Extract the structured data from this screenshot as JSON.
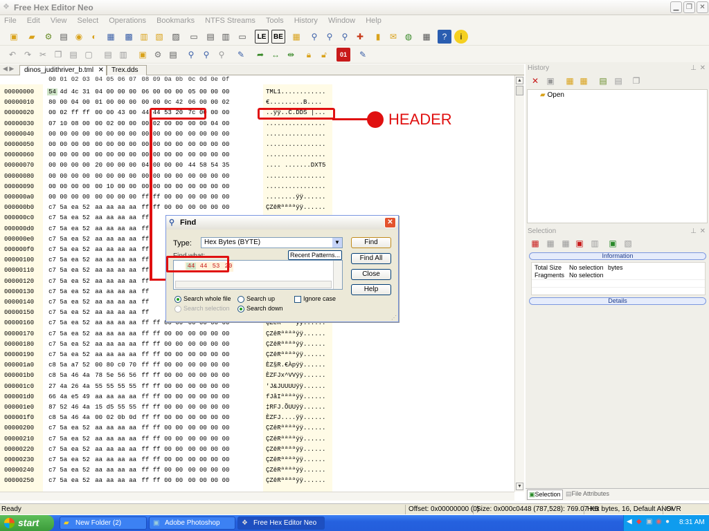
{
  "window": {
    "title": "Free Hex Editor Neo"
  },
  "menu": [
    "File",
    "Edit",
    "View",
    "Select",
    "Operations",
    "Bookmarks",
    "NTFS Streams",
    "Tools",
    "History",
    "Window",
    "Help"
  ],
  "tabs": [
    {
      "label": "dinos_judithriver_b.tml"
    },
    {
      "label": "Trex.dds"
    }
  ],
  "hex": {
    "columns": [
      "00",
      "01",
      "02",
      "03",
      "04",
      "05",
      "06",
      "07",
      "08",
      "09",
      "0a",
      "0b",
      "0c",
      "0d",
      "0e",
      "0f"
    ],
    "rows": [
      {
        "addr": "00000000",
        "bytes": [
          "54",
          "4d",
          "4c",
          "31",
          "04",
          "00",
          "00",
          "00",
          "06",
          "00",
          "00",
          "00",
          "05",
          "00",
          "00",
          "00"
        ],
        "ascii": "TML1............"
      },
      {
        "addr": "00000010",
        "bytes": [
          "80",
          "00",
          "04",
          "00",
          "01",
          "00",
          "00",
          "00",
          "00",
          "00",
          "0c",
          "42",
          "06",
          "00",
          "00",
          "02"
        ],
        "ascii": "€.........B...."
      },
      {
        "addr": "00000020",
        "bytes": [
          "00",
          "02",
          "ff",
          "ff",
          "00",
          "00",
          "43",
          "00",
          "44",
          "44",
          "53",
          "20",
          "7c",
          "00",
          "00",
          "00"
        ],
        "ascii": "..ÿÿ..C.DDS |..."
      },
      {
        "addr": "00000030",
        "bytes": [
          "07",
          "10",
          "08",
          "00",
          "00",
          "02",
          "00",
          "00",
          "00",
          "02",
          "00",
          "00",
          "00",
          "00",
          "04",
          "00"
        ],
        "ascii": "................"
      },
      {
        "addr": "00000040",
        "bytes": [
          "00",
          "00",
          "00",
          "00",
          "00",
          "00",
          "00",
          "00",
          "00",
          "00",
          "00",
          "00",
          "00",
          "00",
          "00",
          "00"
        ],
        "ascii": "................"
      },
      {
        "addr": "00000050",
        "bytes": [
          "00",
          "00",
          "00",
          "00",
          "00",
          "00",
          "00",
          "00",
          "00",
          "00",
          "00",
          "00",
          "00",
          "00",
          "00",
          "00"
        ],
        "ascii": "................"
      },
      {
        "addr": "00000060",
        "bytes": [
          "00",
          "00",
          "00",
          "00",
          "00",
          "00",
          "00",
          "00",
          "00",
          "00",
          "00",
          "00",
          "00",
          "00",
          "00",
          "00"
        ],
        "ascii": "................"
      },
      {
        "addr": "00000070",
        "bytes": [
          "00",
          "00",
          "00",
          "00",
          "20",
          "00",
          "00",
          "00",
          "04",
          "00",
          "00",
          "00",
          "44",
          "58",
          "54",
          "35"
        ],
        "ascii": ".... .......DXT5"
      },
      {
        "addr": "00000080",
        "bytes": [
          "00",
          "00",
          "00",
          "00",
          "00",
          "00",
          "00",
          "00",
          "00",
          "00",
          "00",
          "00",
          "00",
          "00",
          "00",
          "00"
        ],
        "ascii": "................"
      },
      {
        "addr": "00000090",
        "bytes": [
          "00",
          "00",
          "00",
          "00",
          "00",
          "10",
          "00",
          "00",
          "00",
          "00",
          "00",
          "00",
          "00",
          "00",
          "00",
          "00"
        ],
        "ascii": "................"
      },
      {
        "addr": "000000a0",
        "bytes": [
          "00",
          "00",
          "00",
          "00",
          "00",
          "00",
          "00",
          "00",
          "ff",
          "ff",
          "00",
          "00",
          "00",
          "00",
          "00",
          "00"
        ],
        "ascii": "........ÿÿ......"
      },
      {
        "addr": "000000b0",
        "bytes": [
          "c7",
          "5a",
          "ea",
          "52",
          "aa",
          "aa",
          "aa",
          "aa",
          "ff",
          "ff",
          "00",
          "00",
          "00",
          "00",
          "00",
          "00"
        ],
        "ascii": "ÇZêRªªªªÿÿ......"
      },
      {
        "addr": "000000c0",
        "bytes": [
          "c7",
          "5a",
          "ea",
          "52",
          "aa",
          "aa",
          "aa",
          "aa",
          "ff",
          "",
          "",
          "",
          "",
          "",
          "",
          ""
        ],
        "ascii": ""
      },
      {
        "addr": "000000d0",
        "bytes": [
          "c7",
          "5a",
          "ea",
          "52",
          "aa",
          "aa",
          "aa",
          "aa",
          "ff",
          "",
          "",
          "",
          "",
          "",
          "",
          ""
        ],
        "ascii": ""
      },
      {
        "addr": "000000e0",
        "bytes": [
          "c7",
          "5a",
          "ea",
          "52",
          "aa",
          "aa",
          "aa",
          "aa",
          "ff",
          "",
          "",
          "",
          "",
          "",
          "",
          ""
        ],
        "ascii": ""
      },
      {
        "addr": "000000f0",
        "bytes": [
          "c7",
          "5a",
          "ea",
          "52",
          "aa",
          "aa",
          "aa",
          "aa",
          "ff",
          "",
          "",
          "",
          "",
          "",
          "",
          ""
        ],
        "ascii": ""
      },
      {
        "addr": "00000100",
        "bytes": [
          "c7",
          "5a",
          "ea",
          "52",
          "aa",
          "aa",
          "aa",
          "aa",
          "ff",
          "",
          "",
          "",
          "",
          "",
          "",
          ""
        ],
        "ascii": ""
      },
      {
        "addr": "00000110",
        "bytes": [
          "c7",
          "5a",
          "ea",
          "52",
          "aa",
          "aa",
          "aa",
          "aa",
          "ff",
          "",
          "",
          "",
          "",
          "",
          "",
          ""
        ],
        "ascii": ""
      },
      {
        "addr": "00000120",
        "bytes": [
          "c7",
          "5a",
          "ea",
          "52",
          "aa",
          "aa",
          "aa",
          "aa",
          "ff",
          "",
          "",
          "",
          "",
          "",
          "",
          ""
        ],
        "ascii": ""
      },
      {
        "addr": "00000130",
        "bytes": [
          "c7",
          "5a",
          "ea",
          "52",
          "aa",
          "aa",
          "aa",
          "aa",
          "ff",
          "",
          "",
          "",
          "",
          "",
          "",
          ""
        ],
        "ascii": ""
      },
      {
        "addr": "00000140",
        "bytes": [
          "c7",
          "5a",
          "ea",
          "52",
          "aa",
          "aa",
          "aa",
          "aa",
          "ff",
          "",
          "",
          "",
          "",
          "",
          "",
          ""
        ],
        "ascii": ""
      },
      {
        "addr": "00000150",
        "bytes": [
          "c7",
          "5a",
          "ea",
          "52",
          "aa",
          "aa",
          "aa",
          "aa",
          "ff",
          "",
          "",
          "",
          "",
          "",
          "",
          ""
        ],
        "ascii": ""
      },
      {
        "addr": "00000160",
        "bytes": [
          "c7",
          "5a",
          "ea",
          "52",
          "aa",
          "aa",
          "aa",
          "aa",
          "ff",
          "ff",
          "00",
          "00",
          "00",
          "00",
          "00",
          "00"
        ],
        "ascii": "ÇZêRªªªªÿÿ......"
      },
      {
        "addr": "00000170",
        "bytes": [
          "c7",
          "5a",
          "ea",
          "52",
          "aa",
          "aa",
          "aa",
          "aa",
          "ff",
          "ff",
          "00",
          "00",
          "00",
          "00",
          "00",
          "00"
        ],
        "ascii": "ÇZêRªªªªÿÿ......"
      },
      {
        "addr": "00000180",
        "bytes": [
          "c7",
          "5a",
          "ea",
          "52",
          "aa",
          "aa",
          "aa",
          "aa",
          "ff",
          "ff",
          "00",
          "00",
          "00",
          "00",
          "00",
          "00"
        ],
        "ascii": "ÇZêRªªªªÿÿ......"
      },
      {
        "addr": "00000190",
        "bytes": [
          "c7",
          "5a",
          "ea",
          "52",
          "aa",
          "aa",
          "aa",
          "aa",
          "ff",
          "ff",
          "00",
          "00",
          "00",
          "00",
          "00",
          "00"
        ],
        "ascii": "ÇZêRªªªªÿÿ......"
      },
      {
        "addr": "000001a0",
        "bytes": [
          "c8",
          "5a",
          "a7",
          "52",
          "00",
          "80",
          "c0",
          "70",
          "ff",
          "ff",
          "00",
          "00",
          "00",
          "00",
          "00",
          "00"
        ],
        "ascii": "ÈZ§R.€Àpÿÿ......"
      },
      {
        "addr": "000001b0",
        "bytes": [
          "c8",
          "5a",
          "46",
          "4a",
          "78",
          "5e",
          "56",
          "56",
          "ff",
          "ff",
          "00",
          "00",
          "00",
          "00",
          "00",
          "00"
        ],
        "ascii": "ÈZFJx^VVÿÿ......"
      },
      {
        "addr": "000001c0",
        "bytes": [
          "27",
          "4a",
          "26",
          "4a",
          "55",
          "55",
          "55",
          "55",
          "ff",
          "ff",
          "00",
          "00",
          "00",
          "00",
          "00",
          "00"
        ],
        "ascii": "'J&JUUUUÿÿ......"
      },
      {
        "addr": "000001d0",
        "bytes": [
          "66",
          "4a",
          "e5",
          "49",
          "aa",
          "aa",
          "aa",
          "aa",
          "ff",
          "ff",
          "00",
          "00",
          "00",
          "00",
          "00",
          "00"
        ],
        "ascii": "fJåIªªªªÿÿ......"
      },
      {
        "addr": "000001e0",
        "bytes": [
          "87",
          "52",
          "46",
          "4a",
          "15",
          "d5",
          "55",
          "55",
          "ff",
          "ff",
          "00",
          "00",
          "00",
          "00",
          "00",
          "00"
        ],
        "ascii": "‡RFJ.ÕUUÿÿ......"
      },
      {
        "addr": "000001f0",
        "bytes": [
          "c8",
          "5a",
          "46",
          "4a",
          "00",
          "02",
          "0b",
          "0d",
          "ff",
          "ff",
          "00",
          "00",
          "00",
          "00",
          "00",
          "00"
        ],
        "ascii": "ÈZFJ....ÿÿ......"
      },
      {
        "addr": "00000200",
        "bytes": [
          "c7",
          "5a",
          "ea",
          "52",
          "aa",
          "aa",
          "aa",
          "aa",
          "ff",
          "ff",
          "00",
          "00",
          "00",
          "00",
          "00",
          "00"
        ],
        "ascii": "ÇZêRªªªªÿÿ......"
      },
      {
        "addr": "00000210",
        "bytes": [
          "c7",
          "5a",
          "ea",
          "52",
          "aa",
          "aa",
          "aa",
          "aa",
          "ff",
          "ff",
          "00",
          "00",
          "00",
          "00",
          "00",
          "00"
        ],
        "ascii": "ÇZêRªªªªÿÿ......"
      },
      {
        "addr": "00000220",
        "bytes": [
          "c7",
          "5a",
          "ea",
          "52",
          "aa",
          "aa",
          "aa",
          "aa",
          "ff",
          "ff",
          "00",
          "00",
          "00",
          "00",
          "00",
          "00"
        ],
        "ascii": "ÇZêRªªªªÿÿ......"
      },
      {
        "addr": "00000230",
        "bytes": [
          "c7",
          "5a",
          "ea",
          "52",
          "aa",
          "aa",
          "aa",
          "aa",
          "ff",
          "ff",
          "00",
          "00",
          "00",
          "00",
          "00",
          "00"
        ],
        "ascii": "ÇZêRªªªªÿÿ......"
      },
      {
        "addr": "00000240",
        "bytes": [
          "c7",
          "5a",
          "ea",
          "52",
          "aa",
          "aa",
          "aa",
          "aa",
          "ff",
          "ff",
          "00",
          "00",
          "00",
          "00",
          "00",
          "00"
        ],
        "ascii": "ÇZêRªªªªÿÿ......"
      },
      {
        "addr": "00000250",
        "bytes": [
          "c7",
          "5a",
          "ea",
          "52",
          "aa",
          "aa",
          "aa",
          "aa",
          "ff",
          "ff",
          "00",
          "00",
          "00",
          "00",
          "00",
          "00"
        ],
        "ascii": "ÇZêRªªªªÿÿ......"
      }
    ]
  },
  "annotation": {
    "label": "HEADER",
    "color": "#e01010"
  },
  "find_dialog": {
    "title": "Find",
    "type_label": "Type:",
    "type_value": "Hex Bytes (BYTE)",
    "find_what_label": "Find what:",
    "recent_patterns": "Recent Patterns...",
    "pattern": [
      "44",
      "44",
      "53",
      "20"
    ],
    "buttons": {
      "find": "Find",
      "find_all": "Find All",
      "close": "Close",
      "help": "Help"
    },
    "options": {
      "search_whole_file": "Search whole file",
      "search_selection": "Search selection",
      "search_up": "Search up",
      "search_down": "Search down",
      "ignore_case": "Ignore case"
    }
  },
  "history_panel": {
    "title": "History",
    "items": [
      "Open"
    ]
  },
  "selection_panel": {
    "title": "Selection",
    "information_label": "Information",
    "details_label": "Details",
    "rows": [
      {
        "name": "Total Size",
        "value": "No selection",
        "unit": "bytes"
      },
      {
        "name": "Fragments",
        "value": "No selection",
        "unit": ""
      }
    ],
    "bottom_tabs": [
      "Selection",
      "File Attributes"
    ]
  },
  "status": {
    "ready": "Ready",
    "offset": "Offset: 0x00000000 (0)",
    "size": "Size: 0x000c0448 (787,528): 769.07 KB",
    "mode": "Hex bytes, 16, Default ANSI",
    "ovr": "OVR"
  },
  "taskbar": {
    "start": "start",
    "tasks": [
      {
        "label": "New Folder (2)",
        "active": false
      },
      {
        "label": "Adobe Photoshop",
        "active": false
      },
      {
        "label": "Free Hex Editor Neo",
        "active": true
      }
    ],
    "clock": "8:31 AM"
  }
}
